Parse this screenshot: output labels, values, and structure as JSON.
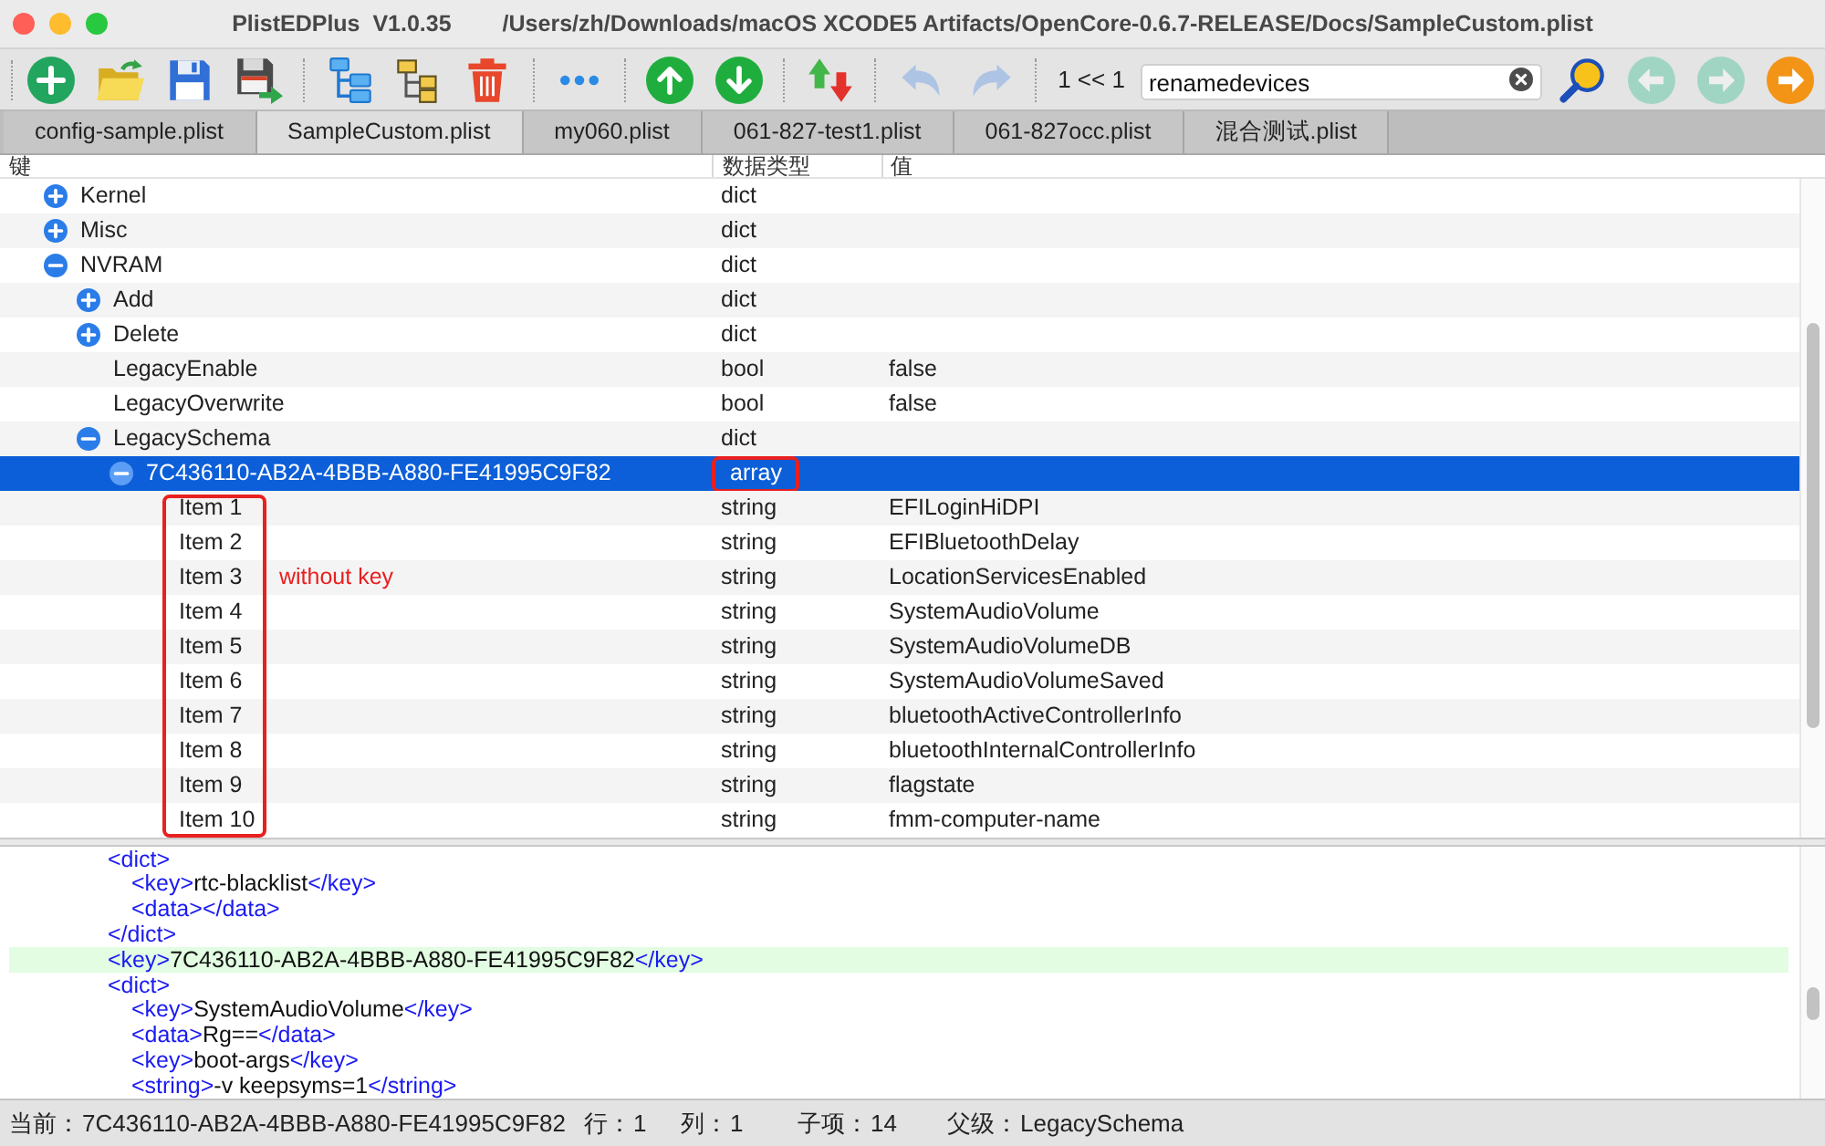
{
  "window": {
    "title": "PlistEDPlus  V1.0.35",
    "path": "/Users/zh/Downloads/macOS XCODE5 Artifacts/OpenCore-0.6.7-RELEASE/Docs/SampleCustom.plist"
  },
  "toolbar": {
    "buttons": [
      {
        "disabled": false
      },
      {
        "disabled": false
      },
      {
        "disabled": false
      },
      {
        "disabled": false
      },
      {
        "disabled": false
      },
      {
        "disabled": false
      },
      {
        "disabled": false
      },
      {
        "disabled": false
      },
      {
        "disabled": false
      },
      {
        "disabled": false
      },
      {
        "disabled": false
      },
      {
        "disabled": true
      },
      {
        "disabled": true
      }
    ],
    "search": {
      "match_count": "1 << 1",
      "value": "renamedevices",
      "buttons": [
        {
          "disabled": false
        },
        {
          "disabled": true
        },
        {
          "disabled": true
        },
        {
          "disabled": false
        }
      ]
    }
  },
  "tabs": [
    {
      "label": "config-sample.plist",
      "selected": false
    },
    {
      "label": "SampleCustom.plist",
      "selected": true
    },
    {
      "label": "my060.plist",
      "selected": false
    },
    {
      "label": "061-827-test1.plist",
      "selected": false
    },
    {
      "label": "061-827occ.plist",
      "selected": false
    },
    {
      "label": "混合测试.plist",
      "selected": false
    }
  ],
  "tree": {
    "columns": [
      "键",
      "数据类型",
      "值"
    ],
    "rows": [
      {
        "key": "Kernel",
        "type": "dict",
        "expanded": false,
        "selected": false
      },
      {
        "key": "Misc",
        "type": "dict",
        "expanded": false,
        "selected": false
      },
      {
        "key": "NVRAM",
        "type": "dict",
        "expanded": true,
        "selected": false,
        "children": [
          {
            "key": "Add",
            "type": "dict",
            "expanded": false,
            "selected": false
          },
          {
            "key": "Delete",
            "type": "dict",
            "expanded": false,
            "selected": false
          },
          {
            "key": "LegacyEnable",
            "type": "bool",
            "value": "false",
            "selected": false
          },
          {
            "key": "LegacyOverwrite",
            "type": "bool",
            "value": "false",
            "selected": false
          },
          {
            "key": "LegacySchema",
            "type": "dict",
            "expanded": true,
            "selected": false,
            "children": [
              {
                "key": "7C436110-AB2A-4BBB-A880-FE41995C9F82",
                "type": "array",
                "expanded": true,
                "selected": true,
                "children": [
                  {
                    "key": "Item 1",
                    "type": "string",
                    "value": "EFILoginHiDPI",
                    "selected": false
                  },
                  {
                    "key": "Item 2",
                    "type": "string",
                    "value": "EFIBluetoothDelay",
                    "selected": false
                  },
                  {
                    "key": "Item 3",
                    "type": "string",
                    "value": "LocationServicesEnabled",
                    "selected": false
                  },
                  {
                    "key": "Item 4",
                    "type": "string",
                    "value": "SystemAudioVolume",
                    "selected": false
                  },
                  {
                    "key": "Item 5",
                    "type": "string",
                    "value": "SystemAudioVolumeDB",
                    "selected": false
                  },
                  {
                    "key": "Item 6",
                    "type": "string",
                    "value": "SystemAudioVolumeSaved",
                    "selected": false
                  },
                  {
                    "key": "Item 7",
                    "type": "string",
                    "value": "bluetoothActiveControllerInfo",
                    "selected": false
                  },
                  {
                    "key": "Item 8",
                    "type": "string",
                    "value": "bluetoothInternalControllerInfo",
                    "selected": false
                  },
                  {
                    "key": "Item 9",
                    "type": "string",
                    "value": "flagstate",
                    "selected": false
                  },
                  {
                    "key": "Item 10",
                    "type": "string",
                    "value": "fmm-computer-name",
                    "selected": false
                  }
                ]
              }
            ]
          }
        ]
      }
    ]
  },
  "annotation": {
    "note": "without key"
  },
  "xml": {
    "lines": [
      {
        "text": "<dict>",
        "current": false,
        "children": [
          {
            "text": "<key>rtc-blacklist</key>",
            "current": false
          },
          {
            "text": "<data></data>",
            "current": false
          }
        ]
      },
      {
        "text": "</dict>",
        "current": false
      },
      {
        "text": "<key>7C436110-AB2A-4BBB-A880-FE41995C9F82</key>",
        "current": true
      },
      {
        "text": "<dict>",
        "current": false,
        "children": [
          {
            "text": "<key>SystemAudioVolume</key>",
            "current": false
          },
          {
            "text": "<data>Rg==</data>",
            "current": false
          },
          {
            "text": "<key>boot-args</key>",
            "current": false
          },
          {
            "text": "<string>-v keepsyms=1</string>",
            "current": false
          }
        ]
      }
    ]
  },
  "status_bar": [
    {
      "label": "当前：",
      "value": "7C436110-AB2A-4BBB-A880-FE41995C9F82"
    },
    {
      "label": "行：",
      "value": "1"
    },
    {
      "label": "列：",
      "value": "1"
    },
    {
      "label": "子项：",
      "value": "14"
    },
    {
      "label": "父级：",
      "value": "LegacySchema"
    }
  ]
}
